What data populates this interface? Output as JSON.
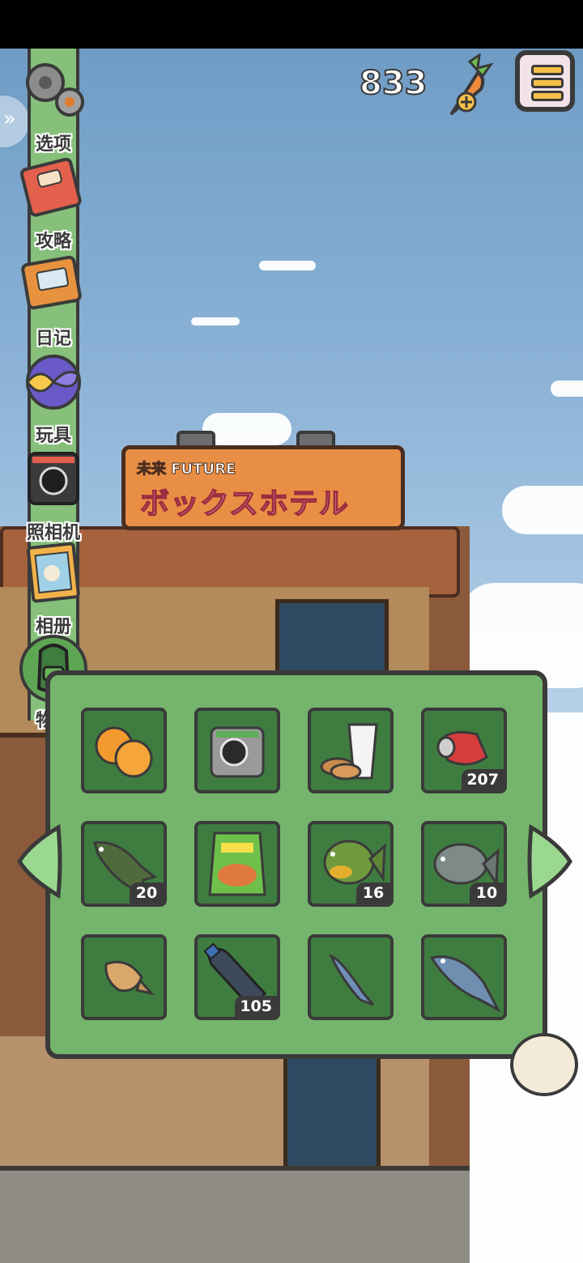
{
  "hud": {
    "carrot_count": "833",
    "carrot_icon": "carrot-plus-icon",
    "menu_icon": "menu-list-icon"
  },
  "sign": {
    "small_text": "未来 FUTURE",
    "big_text": "ボックスホテル"
  },
  "side_menu": {
    "items": [
      {
        "label": "选项",
        "icon": "gear-icon"
      },
      {
        "label": "攻略",
        "icon": "guide-book-icon"
      },
      {
        "label": "日记",
        "icon": "diary-icon"
      },
      {
        "label": "玩具",
        "icon": "toy-icon"
      },
      {
        "label": "照相机",
        "icon": "camera-icon"
      },
      {
        "label": "相册",
        "icon": "photo-album-icon"
      },
      {
        "label": "物品",
        "icon": "backpack-icon"
      }
    ]
  },
  "inventory": {
    "items": [
      {
        "icon": "oranges-icon",
        "count": ""
      },
      {
        "icon": "instant-camera-icon",
        "count": ""
      },
      {
        "icon": "milk-and-cookies-icon",
        "count": ""
      },
      {
        "icon": "crushed-can-icon",
        "count": "207"
      },
      {
        "icon": "bass-fish-icon",
        "count": "20"
      },
      {
        "icon": "snack-bag-icon",
        "count": ""
      },
      {
        "icon": "bluegill-fish-icon",
        "count": "16"
      },
      {
        "icon": "carp-fish-icon",
        "count": "10"
      },
      {
        "icon": "flatfish-icon",
        "count": ""
      },
      {
        "icon": "plastic-bottle-icon",
        "count": "105"
      },
      {
        "icon": "sardine-icon",
        "count": ""
      },
      {
        "icon": "salmon-icon",
        "count": ""
      }
    ]
  },
  "colors": {
    "panel": "#75b46c",
    "slot": "#3f7c40",
    "outline": "#3a3a3a",
    "sky": "#8fb5d8"
  }
}
